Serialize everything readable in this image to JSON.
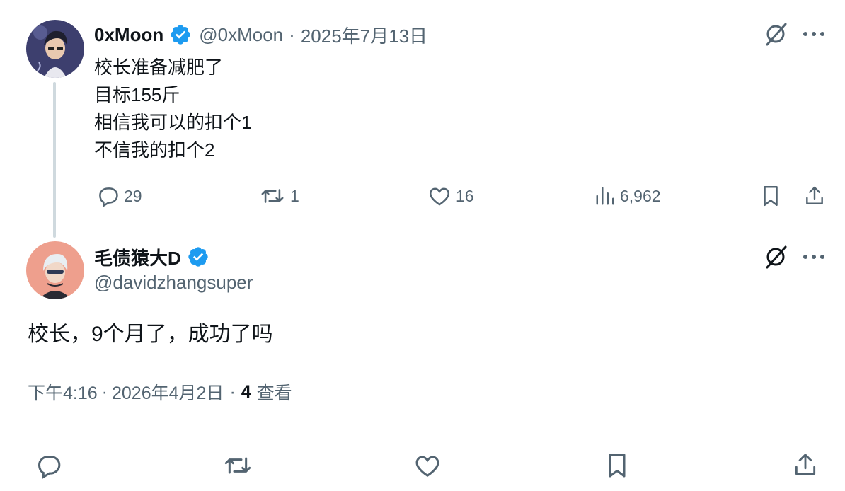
{
  "parent_tweet": {
    "name": "0xMoon",
    "handle": "@0xMoon",
    "separator": "·",
    "date": "2025年7月13日",
    "lines": [
      "校长准备减肥了",
      "目标155斤",
      "相信我可以的扣个1",
      "不信我的扣个2"
    ],
    "replies": "29",
    "retweets": "1",
    "likes": "16",
    "views": "6,962"
  },
  "reply_tweet": {
    "name": "毛债猿大D",
    "handle": "@davidzhangsuper",
    "text": "校长，9个月了，成功了吗",
    "time": "下午4:16",
    "separator": "·",
    "date": "2026年4月2日",
    "separator2": "·",
    "views_count": "4",
    "views_label": "查看"
  },
  "colors": {
    "verified": "#1d9bf0",
    "muted": "#536471",
    "text": "#0f1419",
    "thread_line": "#cfd9de"
  },
  "icons": [
    "grok-icon",
    "more-icon",
    "reply-icon",
    "retweet-icon",
    "like-icon",
    "views-icon",
    "bookmark-icon",
    "share-icon",
    "verified-badge-icon"
  ]
}
